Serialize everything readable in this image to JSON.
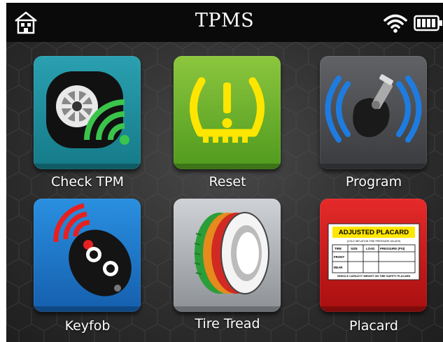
{
  "header": {
    "title": "TPMS",
    "home_icon": "home-icon",
    "wifi_icon": "wifi-icon",
    "battery_icon": "battery-icon"
  },
  "tiles": [
    {
      "label": "Check TPM",
      "icon": "tire-signal-icon",
      "color": "#1f8f9e"
    },
    {
      "label": "Reset",
      "icon": "tpms-warning-icon",
      "color": "#6fb030",
      "icon_color": "#ffe600"
    },
    {
      "label": "Program",
      "icon": "sensor-valve-icon",
      "color": "#4a4b4f"
    },
    {
      "label": "Keyfob",
      "icon": "keyfob-icon",
      "color": "#1f78c8"
    },
    {
      "label": "Tire Tread",
      "icon": "tire-tread-icon",
      "color": "#b4b7bb"
    },
    {
      "label": "Placard",
      "icon": "placard-icon",
      "color": "#cc1c1c"
    }
  ],
  "placard": {
    "title": "ADJUSTED PLACARD",
    "subtitle": "(COLD INFLATION TIRE PRESSURE VALUES)",
    "headers": [
      "TIRE",
      "SIZE",
      "LOAD",
      "PRESSURE (PSI)"
    ],
    "rows": [
      "FRONT",
      "REAR"
    ],
    "footer": "VEHICLE CAPACITY WEIGHT ON TIRE SAFETY PLACARD"
  }
}
